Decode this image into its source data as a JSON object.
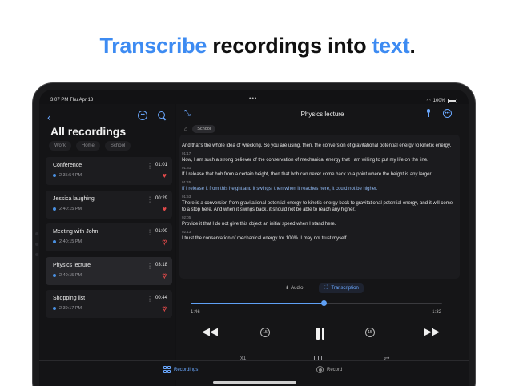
{
  "headline": {
    "accent1": "Transcribe",
    "middle": "recordings into",
    "accent2": "text",
    "end": "."
  },
  "status": {
    "time": "3:07 PM  Thu Apr 13",
    "dots": "•••",
    "battery": "100%"
  },
  "sidebar": {
    "title": "All recordings",
    "chips": [
      "Work",
      "Home",
      "School"
    ],
    "recordings": [
      {
        "name": "Conference",
        "time": "2:35:54 PM",
        "duration": "01:01",
        "favorite": true,
        "selected": false
      },
      {
        "name": "Jessica laughing",
        "time": "2:40:15 PM",
        "duration": "00:29",
        "favorite": true,
        "selected": false
      },
      {
        "name": "Meeting with John",
        "time": "2:40:15 PM",
        "duration": "01:00",
        "favorite": false,
        "selected": false
      },
      {
        "name": "Physics lecture",
        "time": "2:40:15 PM",
        "duration": "03:18",
        "favorite": false,
        "selected": true
      },
      {
        "name": "Shopping list",
        "time": "2:39:17 PM",
        "duration": "00:44",
        "favorite": false,
        "selected": false
      }
    ]
  },
  "main": {
    "title": "Physics lecture",
    "tag": "School",
    "transcript": [
      {
        "time": "",
        "text": "And that's the whole idea of wrecking. So you are using, then, the conversion of gravitational potential energy to kinetic energy.",
        "active": false
      },
      {
        "time": "01:17",
        "text": "Now, I am such a strong believer of the conservation of mechanical energy that I am willing to put my life on the line.",
        "active": false
      },
      {
        "time": "01:31",
        "text": "If I release that bob from a certain height, then that bob can never come back to a point where the height is any larger.",
        "active": false
      },
      {
        "time": "01:45",
        "text": "If I release it from this height and it swings, then when it reaches here, it could not be higher.",
        "active": true
      },
      {
        "time": "01:53",
        "text": "There is a conversion from gravitational potential energy to kinetic energy back to gravitational potential energy, and it will come to a stop here. And when it swings back, it should not be able to reach any higher.",
        "active": false
      },
      {
        "time": "02:05",
        "text": "Provide it that I do not give this object an initial speed when I stand here.",
        "active": false
      },
      {
        "time": "02:13",
        "text": "I trust the conservation of mechanical energy for 100%. I may not trust myself.",
        "active": false
      }
    ],
    "mode_audio": "Audio",
    "mode_transcription": "Transcription",
    "progress": 0.53,
    "elapsed": "1:46",
    "remaining": "-1:32",
    "skip_back": "15",
    "skip_fwd": "15",
    "speed": "x1"
  },
  "tabbar": {
    "recordings": "Recordings",
    "record": "Record"
  },
  "colors": {
    "accent": "#3d8bf2",
    "heart": "#e34a4a"
  }
}
